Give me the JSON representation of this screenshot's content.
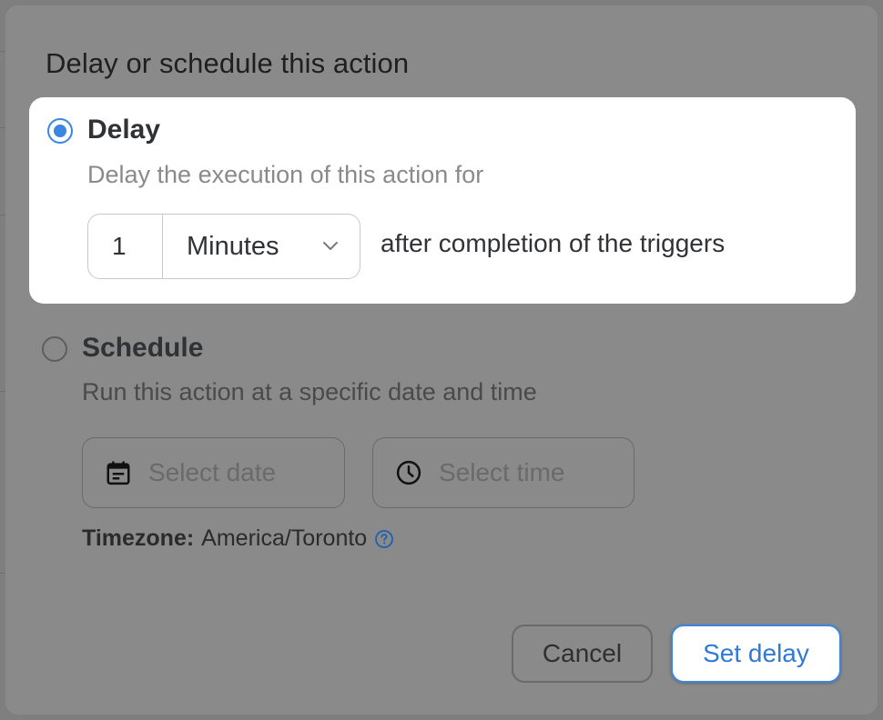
{
  "dialog": {
    "title": "Delay or schedule this action"
  },
  "delay_option": {
    "title": "Delay",
    "description": "Delay the execution of this action for",
    "selected": true,
    "amount": "1",
    "unit": "Minutes",
    "suffix": "after completion of the triggers"
  },
  "schedule_option": {
    "title": "Schedule",
    "description": "Run this action at a specific date and time",
    "selected": false,
    "date_placeholder": "Select date",
    "time_placeholder": "Select time",
    "timezone_label": "Timezone",
    "timezone_value": "America/Toronto"
  },
  "buttons": {
    "cancel": "Cancel",
    "submit": "Set delay"
  },
  "colors": {
    "accent": "#3a86e0",
    "overlay": "#8a8a8a",
    "card": "#ffffff"
  }
}
